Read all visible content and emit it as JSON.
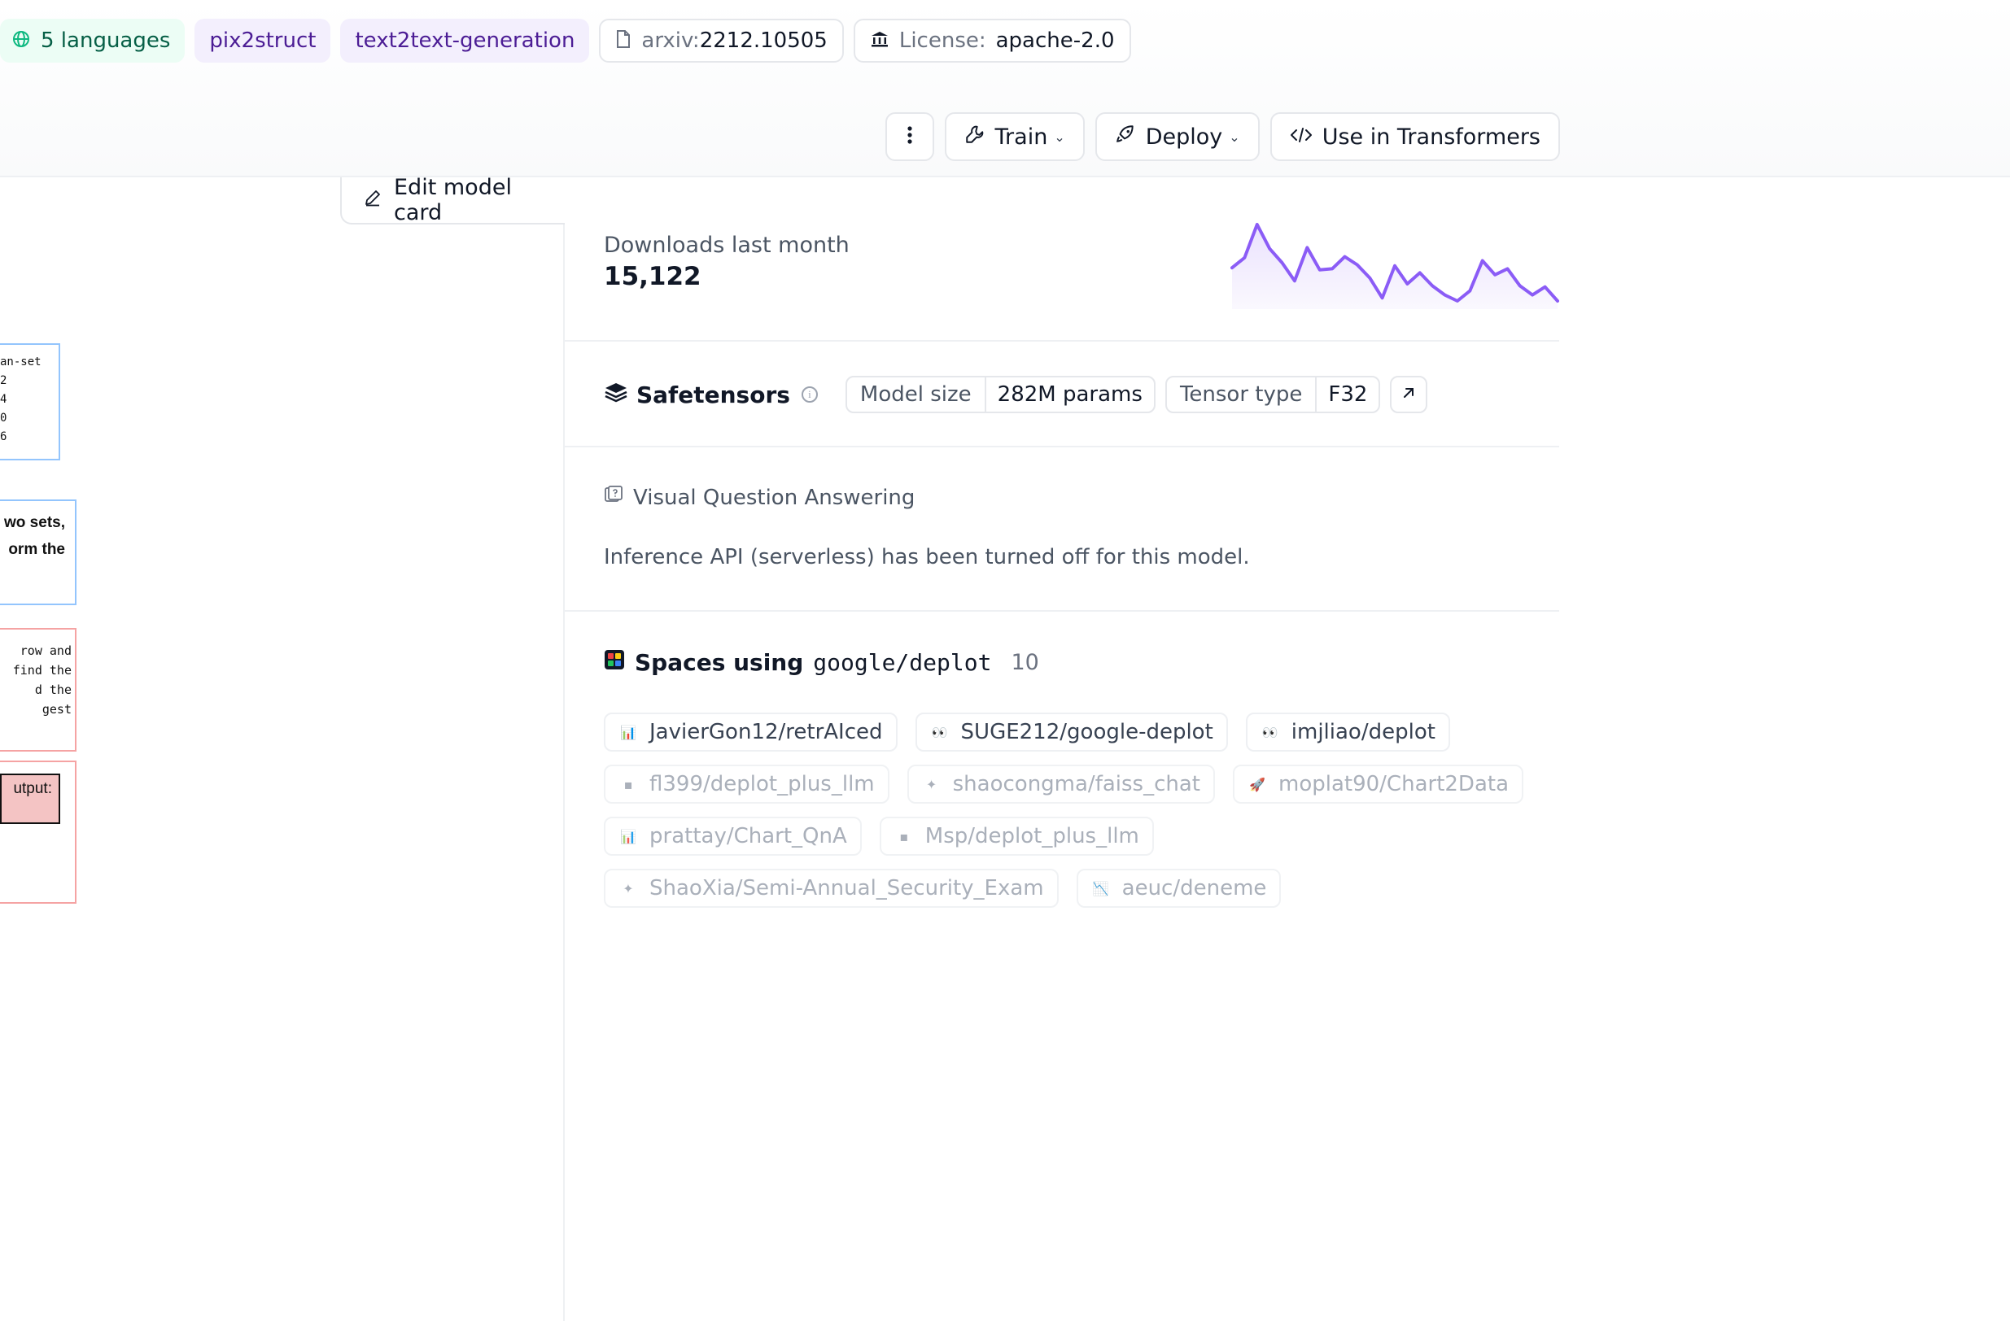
{
  "tags": {
    "languages": "5 languages",
    "library": "pix2struct",
    "task": "text2text-generation",
    "arxiv_prefix": "arxiv:",
    "arxiv_id": "2212.10505",
    "license_label": "License:",
    "license_value": "apache-2.0"
  },
  "actions": {
    "more_icon": "vertical-dots-icon",
    "train": "Train",
    "deploy": "Deploy",
    "use_in": "Use in Transformers"
  },
  "left": {
    "edit_model_card": "Edit model card",
    "figure_boxes": {
      "box1": [
        "an-set",
        "2",
        "4",
        "0",
        "6"
      ],
      "box2": [
        "wo sets,",
        "orm the"
      ],
      "box3": [
        "row and",
        "find the",
        "d the",
        "gest"
      ],
      "box4": "utput:"
    }
  },
  "downloads": {
    "label": "Downloads last month",
    "value": "15,122",
    "sparkline": [
      33,
      43,
      76,
      52,
      38,
      20,
      53,
      31,
      32,
      44,
      36,
      23,
      3,
      35,
      17,
      28,
      15,
      6,
      0,
      10,
      40,
      26,
      32,
      15,
      6,
      14,
      0
    ],
    "color": "#8b5cf6"
  },
  "safetensors": {
    "title": "Safetensors",
    "model_size_label": "Model size",
    "model_size_value": "282M params",
    "tensor_type_label": "Tensor type",
    "tensor_type_value": "F32"
  },
  "inference": {
    "task": "Visual Question Answering",
    "status": "Inference API (serverless) has been turned off for this model."
  },
  "spaces": {
    "title": "Spaces using",
    "model": "google/deplot",
    "count": "10",
    "rows": [
      [
        {
          "name": "JavierGon12/retrAIced",
          "icon": "bar-chart-emoji",
          "glyph": "📊",
          "faded": false
        },
        {
          "name": "SUGE212/google-deplot",
          "icon": "eyes-emoji",
          "glyph": "👀",
          "faded": false
        },
        {
          "name": "imjliao/deplot",
          "icon": "eyes-emoji",
          "glyph": "👀",
          "faded": false
        }
      ],
      [
        {
          "name": "fl399/deplot_plus_llm",
          "icon": "gray-box-emoji",
          "glyph": "▪",
          "faded": true
        },
        {
          "name": "shaocongma/faiss_chat",
          "icon": "sparkle-emoji",
          "glyph": "✦",
          "faded": true
        },
        {
          "name": "moplat90/Chart2Data",
          "icon": "rocket-emoji",
          "glyph": "🚀",
          "faded": true
        }
      ],
      [
        {
          "name": "prattay/Chart_QnA",
          "icon": "bar-chart-emoji",
          "glyph": "📊",
          "faded": true
        },
        {
          "name": "Msp/deplot_plus_llm",
          "icon": "gray-box-emoji",
          "glyph": "▪",
          "faded": true
        }
      ],
      [
        {
          "name": "ShaoXia/Semi-Annual_Security_Exam",
          "icon": "sparkle-emoji",
          "glyph": "✦",
          "faded": true
        },
        {
          "name": "aeuc/deneme",
          "icon": "chart-down-emoji",
          "glyph": "📉",
          "faded": true
        }
      ]
    ]
  }
}
